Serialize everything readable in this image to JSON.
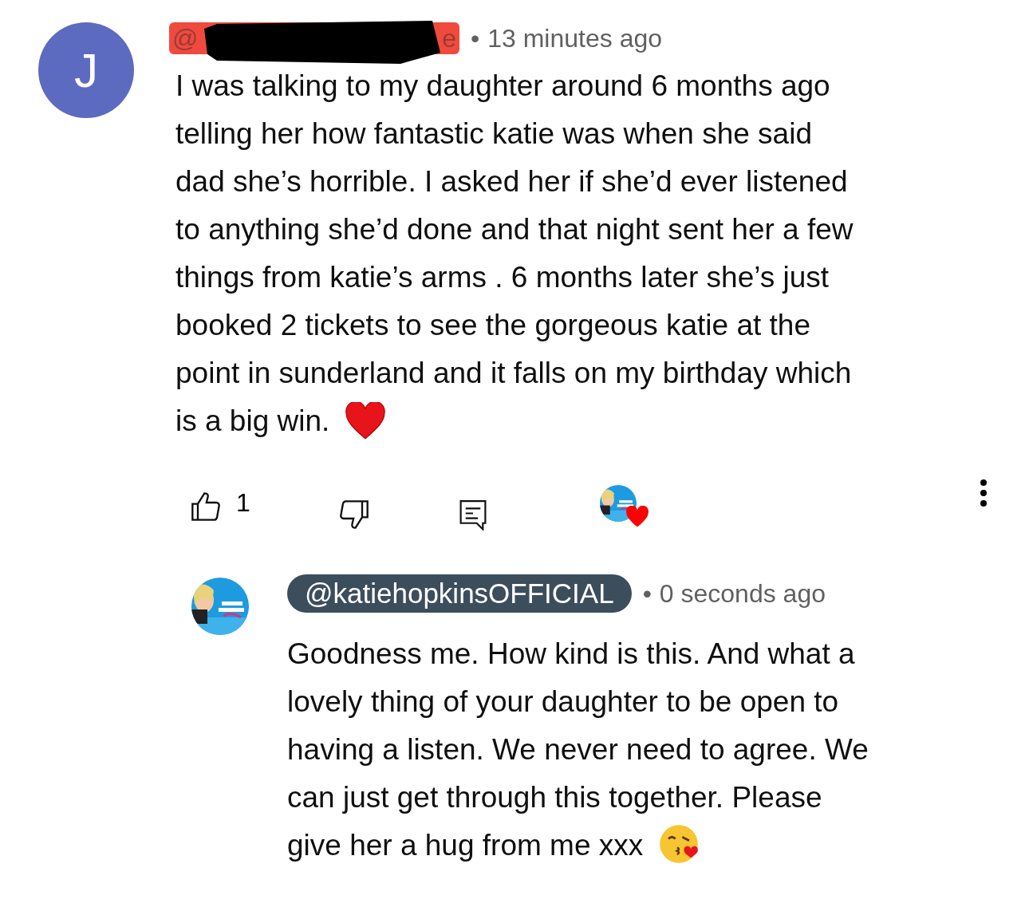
{
  "comment": {
    "avatar_letter": "J",
    "author_fragments": [
      "@",
      "e"
    ],
    "author_redacted": true,
    "separator": "•",
    "time": "13 minutes ago",
    "body_lines": [
      "I was talking to my daughter around 6 months ago",
      "telling her how fantastic katie was when she said",
      "dad she’s horrible. I asked her if she’d ever listened",
      "to anything she’d done and that night sent her a few",
      "things from katie’s arms . 6 months later she’s just",
      "booked 2 tickets to see the gorgeous katie  at the",
      "point in sunderland and it falls on my birthday which",
      "is a big win."
    ],
    "likes": "1",
    "hearted_by_creator": true
  },
  "reply": {
    "author": "@katiehopkinsOFFICIAL",
    "author_is_creator": true,
    "separator": "•",
    "time": "0 seconds ago",
    "body_lines": [
      "Goodness me. How kind is this. And what a",
      "lovely thing of your daughter to be open to",
      "having a listen. We never need to agree. We",
      "can just get through this together. Please",
      "give her a hug from me xxx"
    ]
  }
}
